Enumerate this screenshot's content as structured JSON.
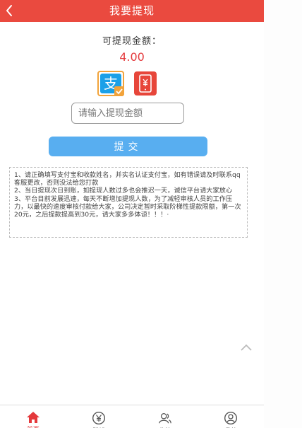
{
  "header": {
    "title": "我要提现"
  },
  "withdraw": {
    "amount_label": "可提现金额：",
    "amount_value": "4.00",
    "alipay_glyph": "支",
    "input_placeholder": "请输入提现金额",
    "submit_label": "提交"
  },
  "notice": {
    "lines": [
      "1、请正确填写支付宝和收款姓名，并实名认证支付宝，如有错误请及时联系qq客服更改，否则没法给您打款",
      "2、当日提现次日到账，如提现人数过多也会推迟一天，诚信平台请大家放心",
      "3、平台目前发展迅速，每天不断增加提现人数，为了减轻审核人员的工作压力，以最快的速度审核付款给大家，公司决定暂时采取阶梯性提款限额，第一次20元，之后提款提高到30元，请大家多多体谅！！！·"
    ]
  },
  "tabbar": {
    "items": [
      {
        "label": "首页",
        "icon": "home-icon"
      },
      {
        "label": "赚钱",
        "icon": "yen-coin-icon"
      },
      {
        "label": "收徒",
        "icon": "users-icon"
      },
      {
        "label": "我的",
        "icon": "user-icon"
      }
    ]
  },
  "colors": {
    "header_bg": "#ea4a3f",
    "amount_red": "#e4393c",
    "submit_blue": "#58aef0",
    "alipay_blue": "#1aa0e8",
    "alipay_border": "#f2a33a",
    "phone_pay_red": "#e7463a"
  },
  "icons": {
    "back": "chevron-left-icon",
    "alipay": "alipay-icon",
    "phone_pay": "phone-yen-icon",
    "scroll_top": "chevron-up-icon"
  }
}
